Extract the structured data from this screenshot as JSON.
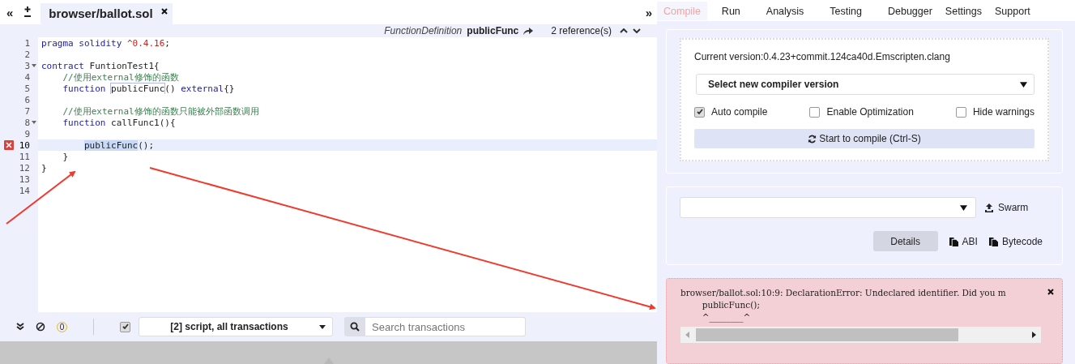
{
  "editor": {
    "collapse_left": "«",
    "collapse_right": "»",
    "tab": {
      "label": "browser/ballot.sol",
      "selected": true
    },
    "info_bar": {
      "kind_label": "FunctionDefinition",
      "name": "publicFunc",
      "references": "2 reference(s)"
    },
    "lines": [
      {
        "number": "1",
        "fold": false,
        "error": false,
        "active": false,
        "segments": [
          {
            "kind": "kw",
            "text": "pragma solidity "
          },
          {
            "kind": "num",
            "text": "^0.4.16"
          },
          {
            "kind": "plain",
            "text": ";"
          }
        ]
      },
      {
        "number": "2",
        "fold": false,
        "error": false,
        "active": false
      },
      {
        "number": "3",
        "fold": true,
        "error": false,
        "active": false,
        "segments": [
          {
            "kind": "kw",
            "text": "contract "
          },
          {
            "kind": "plain",
            "text": "FuntionTest1{"
          }
        ]
      },
      {
        "number": "4",
        "fold": false,
        "error": false,
        "active": false,
        "segments": [
          {
            "kind": "comment",
            "text": "    //使用external修饰的函数"
          }
        ]
      },
      {
        "number": "5",
        "fold": false,
        "error": false,
        "active": false,
        "segments": [
          {
            "kind": "kw",
            "text": "    function "
          },
          {
            "kind": "ref",
            "text": "publicFunc"
          },
          {
            "kind": "plain",
            "text": "() "
          },
          {
            "kind": "kw",
            "text": "external"
          },
          {
            "kind": "plain",
            "text": "{}"
          }
        ]
      },
      {
        "number": "6",
        "fold": false,
        "error": false,
        "active": false
      },
      {
        "number": "7",
        "fold": false,
        "error": false,
        "active": false,
        "segments": [
          {
            "kind": "comment",
            "text": "    //使用external修饰的函数只能被外部函数调用"
          }
        ]
      },
      {
        "number": "8",
        "fold": true,
        "error": false,
        "active": false,
        "segments": [
          {
            "kind": "kw",
            "text": "    function "
          },
          {
            "kind": "plain",
            "text": "callFunc1(){"
          }
        ]
      },
      {
        "number": "9",
        "fold": false,
        "error": false,
        "active": false
      },
      {
        "number": "10",
        "fold": false,
        "error": true,
        "active": true,
        "segments": [
          {
            "kind": "sel",
            "text": "publicFunc"
          },
          {
            "kind": "plain",
            "text": "();"
          }
        ]
      },
      {
        "number": "11",
        "fold": false,
        "error": false,
        "active": false,
        "segments": [
          {
            "kind": "plain",
            "text": "    }"
          }
        ]
      },
      {
        "number": "12",
        "fold": false,
        "error": false,
        "active": false,
        "segments": [
          {
            "kind": "plain",
            "text": "}"
          }
        ]
      },
      {
        "number": "13",
        "fold": false,
        "error": false,
        "active": false
      },
      {
        "number": "14",
        "fold": false,
        "error": false,
        "active": false
      }
    ]
  },
  "terminal": {
    "badge": "0",
    "listen_checked": true,
    "filter": "[2] script, all transactions",
    "search_placeholder": "Search transactions"
  },
  "tabs": [
    {
      "label": "Compile",
      "selected": true
    },
    {
      "label": "Run",
      "selected": false
    },
    {
      "label": "Analysis",
      "selected": false
    },
    {
      "label": "Testing",
      "selected": false
    },
    {
      "label": "Debugger",
      "selected": false
    },
    {
      "label": "Settings",
      "selected": false
    },
    {
      "label": "Support",
      "selected": false
    }
  ],
  "compile": {
    "current_version": "Current version:0.4.23+commit.124ca40d.Emscripten.clang",
    "version_select": "Select new compiler version",
    "options": [
      {
        "label": "Auto compile",
        "checked": true
      },
      {
        "label": "Enable Optimization",
        "checked": false
      },
      {
        "label": "Hide warnings",
        "checked": false
      }
    ],
    "compile_button": "Start to compile (Ctrl-S)"
  },
  "contract": {
    "swarm": "Swarm",
    "details": "Details",
    "abi": "ABI",
    "bytecode": "Bytecode"
  },
  "error": {
    "lines": [
      "browser/ballot.sol:10:9: DeclarationError: Undeclared identifier. Did you m",
      "        publicFunc();",
      "        ^________^"
    ]
  }
}
